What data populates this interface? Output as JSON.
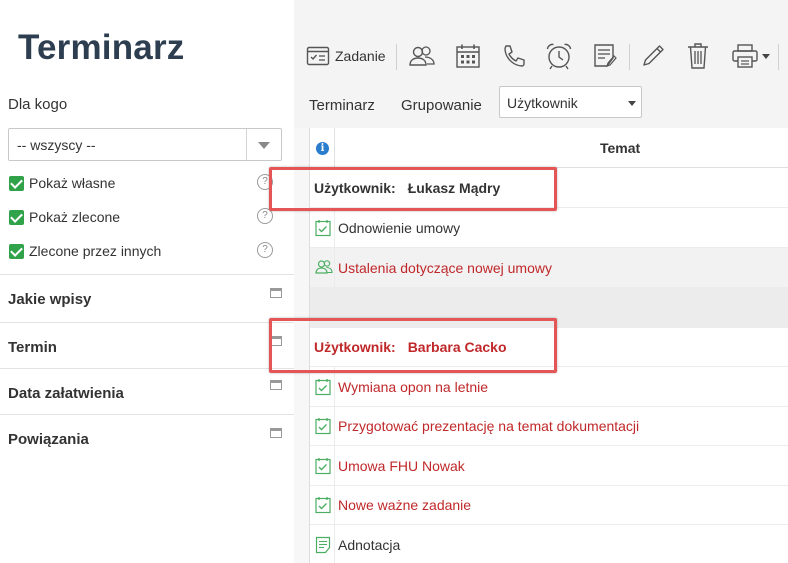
{
  "sidebar": {
    "title": "Terminarz",
    "who_label": "Dla kogo",
    "who_select_value": "-- wszyscy --",
    "checkboxes": [
      {
        "label": "Pokaż własne",
        "checked": true
      },
      {
        "label": "Pokaż zlecone",
        "checked": true
      },
      {
        "label": "Zlecone przez innych",
        "checked": true
      }
    ],
    "sections": [
      "Jakie wpisy",
      "Termin",
      "Data załatwienia",
      "Powiązania"
    ]
  },
  "toolbar": {
    "task_label": "Zadanie",
    "icons": [
      "task-icon",
      "meeting-icon",
      "calendar-icon",
      "phone-icon",
      "alarm-icon",
      "note-icon",
      "edit-icon",
      "delete-icon",
      "print-icon"
    ]
  },
  "subbar": {
    "tab_schedule": "Terminarz",
    "tab_grouping": "Grupowanie",
    "group_select_value": "Użytkownik"
  },
  "grid": {
    "column_title": "Temat",
    "group_prefix": "Użytkownik:",
    "rows": [
      {
        "type": "group",
        "name": "Łukasz Mądry",
        "color": "#333333"
      },
      {
        "type": "item",
        "icon": "task-icon",
        "text": "Odnowienie umowy",
        "color": "#333333"
      },
      {
        "type": "item",
        "icon": "meeting-icon",
        "text": "Ustalenia dotyczące nowej umowy",
        "color": "#c0282a"
      },
      {
        "type": "blank"
      },
      {
        "type": "group",
        "name": "Barbara Cacko",
        "color": "#c0282a"
      },
      {
        "type": "item",
        "icon": "task-icon",
        "text": "Wymiana opon na letnie",
        "color": "#c0282a"
      },
      {
        "type": "item",
        "icon": "task-icon",
        "text": "Przygotować prezentację na temat dokumentacji",
        "color": "#c0282a"
      },
      {
        "type": "item",
        "icon": "task-icon",
        "text": "Umowa FHU Nowak",
        "color": "#c0282a"
      },
      {
        "type": "item",
        "icon": "task-icon",
        "text": "Nowe ważne zadanie",
        "color": "#c0282a"
      },
      {
        "type": "item",
        "icon": "note-icon",
        "text": "Adnotacja",
        "color": "#333333"
      }
    ]
  },
  "colors": {
    "accent_green": "#2fa24a",
    "overdue_red": "#c0282a",
    "highlight_box": "#e45555",
    "title": "#2d3e50"
  }
}
